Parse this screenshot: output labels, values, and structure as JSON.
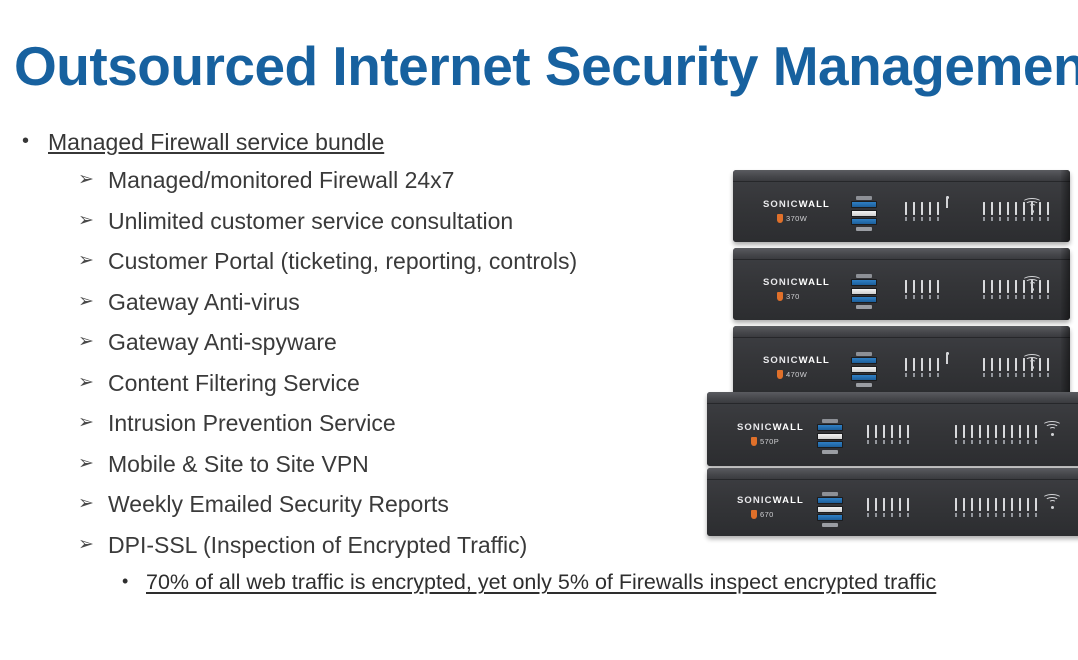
{
  "slide": {
    "title": "Outsourced Internet Security Management",
    "title_color": "#17619f",
    "background_color": "#ffffff",
    "body_text_color": "#3a3a3a"
  },
  "bullets": {
    "level1": {
      "marker": "•",
      "text": "Managed Firewall service bundle",
      "underlined": true
    },
    "level2_marker": "➢",
    "level2": [
      {
        "text": "Managed/monitored Firewall 24x7"
      },
      {
        "text": "Unlimited customer service consultation"
      },
      {
        "text": "Customer Portal (ticketing, reporting, controls)"
      },
      {
        "text": "Gateway Anti-virus"
      },
      {
        "text": "Gateway Anti-spyware"
      },
      {
        "text": "Content Filtering Service"
      },
      {
        "text": "Intrusion Prevention Service"
      },
      {
        "text": "Mobile & Site to Site VPN"
      },
      {
        "text": "Weekly Emailed Security Reports"
      },
      {
        "text": "DPI-SSL (Inspection of Encrypted Traffic)"
      }
    ],
    "level3": {
      "marker": "•",
      "text": "70% of all web traffic is encrypted, yet only 5% of Firewalls inspect encrypted traffic",
      "underlined": true
    }
  },
  "device_stack": {
    "alt": "Stack of five SonicWall TZ series firewall appliances",
    "brand_part1": "SONIC",
    "brand_part2": "WALL",
    "accent_color": "#e0702a",
    "chassis_color": "#343538",
    "port_blue": "#2f7fc4",
    "devices": [
      {
        "model": "370W",
        "wireless": true,
        "wide": false
      },
      {
        "model": "370",
        "wireless": false,
        "wide": false
      },
      {
        "model": "470W",
        "wireless": true,
        "wide": false
      },
      {
        "model": "570P",
        "wireless": false,
        "wide": true
      },
      {
        "model": "670",
        "wireless": false,
        "wide": true
      }
    ]
  }
}
